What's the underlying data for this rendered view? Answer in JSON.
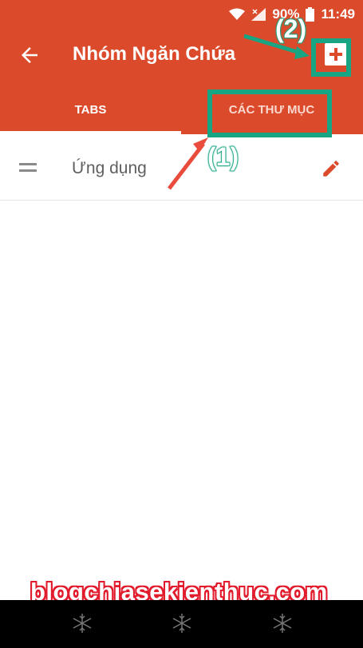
{
  "status_bar": {
    "battery": "90%",
    "time": "11:49",
    "icons": [
      "wifi-icon",
      "signal-icon",
      "battery-icon"
    ]
  },
  "toolbar": {
    "title": "Nhóm Ngăn Chứa",
    "back_icon": "arrow-left-icon",
    "add_icon": "add-box-icon"
  },
  "tabs": [
    {
      "label": "TABS",
      "selected": true
    },
    {
      "label": "CÁC THƯ MỤC",
      "selected": false
    }
  ],
  "list": {
    "items": [
      {
        "label": "Ứng dụng",
        "drag_icon": "drag-handle-icon",
        "edit_icon": "pencil-icon"
      }
    ]
  },
  "annotations": {
    "label_1": "(1)",
    "label_2": "(2)",
    "color": "#18a583",
    "arrow_color": "#e94b3c"
  },
  "watermark": "blogchiasekienthuc.com",
  "nav_bar": {
    "buttons": [
      "back-snowflake-icon",
      "home-snowflake-icon",
      "recents-snowflake-icon"
    ]
  },
  "colors": {
    "primary": "#db4b2b",
    "nav_background": "#000000"
  }
}
